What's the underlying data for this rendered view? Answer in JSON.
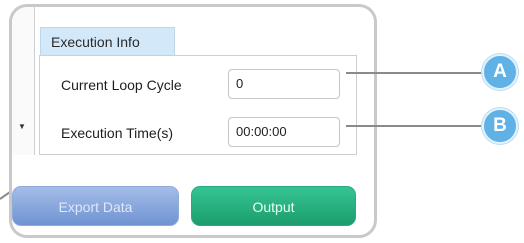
{
  "execution_info": {
    "tab_label": "Execution Info",
    "fields": [
      {
        "label": "Current Loop Cycle",
        "value": "0"
      },
      {
        "label": "Execution Time(s)",
        "value": "00:00:00"
      }
    ]
  },
  "buttons": {
    "export_label": "Export Data",
    "output_label": "Output"
  },
  "callouts": {
    "a_label": "A",
    "b_label": "B"
  },
  "colors": {
    "callout": "#5fb1e6",
    "tab_background": "#d3e8f8",
    "export_button": "#7d9fd8",
    "output_button": "#27b080"
  },
  "icons": {
    "collapse_arrow": "down-triangle-icon"
  }
}
